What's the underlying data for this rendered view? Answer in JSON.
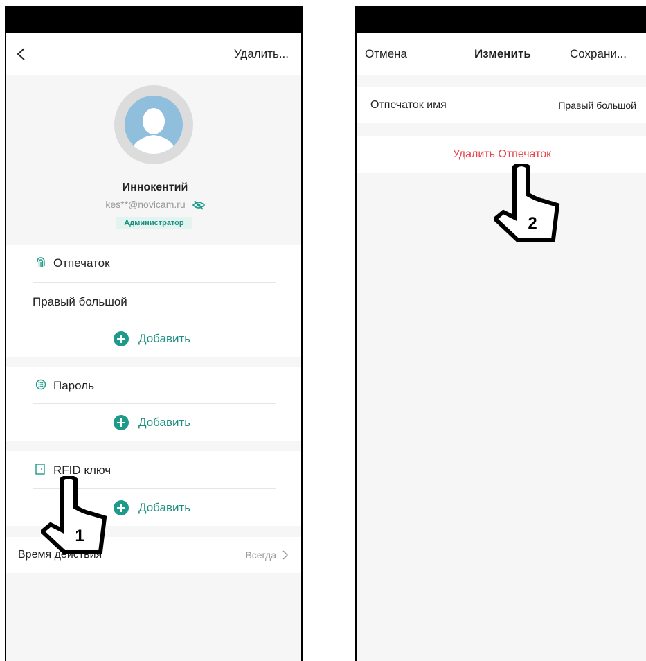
{
  "left_screen": {
    "header": {
      "delete_label": "Удалить..."
    },
    "profile": {
      "name": "Иннокентий",
      "email": "kes**@novicam.ru",
      "role": "Администратор"
    },
    "fingerprint": {
      "title": "Отпечаток",
      "items": [
        "Правый большой"
      ],
      "add_label": "Добавить"
    },
    "password": {
      "title": "Пароль",
      "add_label": "Добавить"
    },
    "rfid": {
      "title": "RFID ключ",
      "add_label": "Добавить"
    },
    "validity": {
      "label": "Время действия",
      "value": "Всегда"
    },
    "pointer_number": "1"
  },
  "right_screen": {
    "header": {
      "cancel_label": "Отмена",
      "title": "Изменить",
      "save_label": "Сохрани..."
    },
    "fingerprint_name": {
      "label": "Отпечаток имя",
      "value": "Правый большой"
    },
    "delete_label": "Удалить Отпечаток",
    "pointer_number": "2"
  },
  "colors": {
    "accent": "#1e9a8a",
    "danger": "#e8434a",
    "background": "#f6f6f6",
    "avatar": "#8fbfdc"
  },
  "icons": [
    "chevron-left-icon",
    "visibility-icon",
    "fingerprint-icon",
    "keypad-icon",
    "card-icon",
    "plus-icon",
    "chevron-right-icon",
    "pointing-hand-icon"
  ]
}
